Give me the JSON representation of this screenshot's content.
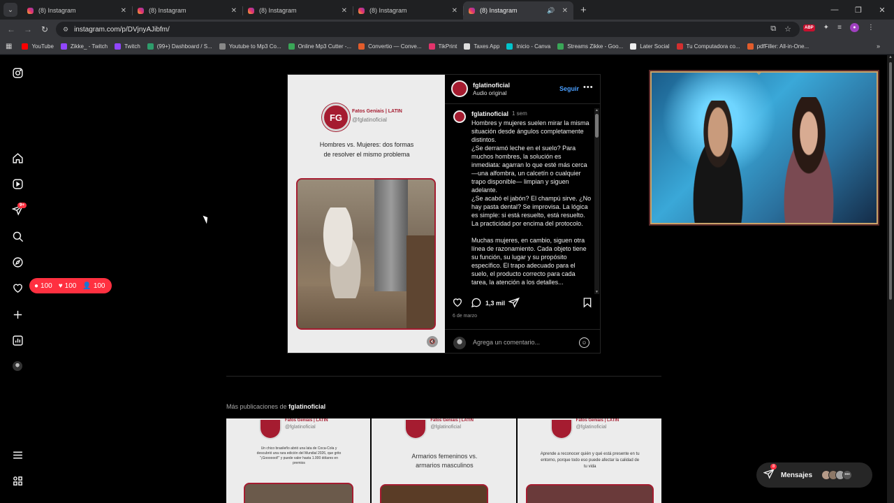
{
  "browser": {
    "tabs": [
      {
        "title": "(8) Instagram",
        "active": false
      },
      {
        "title": "(8) Instagram",
        "active": false
      },
      {
        "title": "(8) Instagram",
        "active": false
      },
      {
        "title": "(8) Instagram",
        "active": false
      },
      {
        "title": "(8) Instagram",
        "active": true
      }
    ],
    "url": "instagram.com/p/DVjnyAJibfm/",
    "bookmarks": [
      {
        "label": "YouTube",
        "color": "#ff0000"
      },
      {
        "label": "Zikke_ - Twitch",
        "color": "#9146ff"
      },
      {
        "label": "Twitch",
        "color": "#9146ff"
      },
      {
        "label": "(99+) Dashboard / S...",
        "color": "#2e9c6b"
      },
      {
        "label": "Youtube to Mp3 Co...",
        "color": "#888888"
      },
      {
        "label": "Online Mp3 Cutter -...",
        "color": "#3aa657"
      },
      {
        "label": "Convertio — Conve...",
        "color": "#e25c2b"
      },
      {
        "label": "TikPrint",
        "color": "#e2336b"
      },
      {
        "label": "Taxes App",
        "color": "#dddddd"
      },
      {
        "label": "Inicio - Canva",
        "color": "#00c4cc"
      },
      {
        "label": "Streams Zikke - Goo...",
        "color": "#3aa657"
      },
      {
        "label": "Later Social",
        "color": "#eeeeee"
      },
      {
        "label": "Tu Computadora co...",
        "color": "#d32f2f"
      },
      {
        "label": "pdfFiller: All-in-One...",
        "color": "#e25c2b"
      }
    ]
  },
  "nav": {
    "badge": "9+",
    "notif_popup": {
      "comments": "100",
      "likes": "100",
      "follows": "100"
    }
  },
  "post": {
    "media": {
      "brand_name": "Fatos Geniais | LATIN",
      "brand_handle": "@fglatinoficial",
      "title": "Hombres vs. Mujeres: dos formas de resolver el mismo problema"
    },
    "header": {
      "username": "fglatinoficial",
      "subtitle": "Audio original",
      "follow_label": "Seguir"
    },
    "caption": {
      "username": "fglatinoficial",
      "time": "1 sem",
      "text": "Hombres y mujeres suelen mirar la misma situación desde ángulos completamente distintos.\n¿Se derramó leche en el suelo? Para muchos hombres, la solución es inmediata: agarran lo que esté más cerca —una alfombra, un calcetín o cualquier trapo disponible— limpian y siguen adelante.\n¿Se acabó el jabón? El champú sirve. ¿No hay pasta dental? Se improvisa. La lógica es simple: si está resuelto, está resuelto. La practicidad por encima del protocolo.\n\nMuchas mujeres, en cambio, siguen otra línea de razonamiento. Cada objeto tiene su función, su lugar y su propósito específico. El trapo adecuado para el suelo, el producto correcto para cada tarea, la atención a los detalles..."
    },
    "comment_count": "1,3 mil",
    "date": "6 de marzo",
    "comment_placeholder": "Agrega un comentario..."
  },
  "more_posts": {
    "prefix": "Más publicaciones de",
    "username": "fglatinoficial",
    "items": [
      {
        "brand": "Fatos Geniais | LATIN",
        "handle": "@fglatinoficial",
        "text": "Un chico brasileño abrió una lata de Coca-Cola y descubrió una rara edición del Mundial 2026, que grito \"¡Gooooool!\" y puede valer hasta 1.000 dólares en premios"
      },
      {
        "brand": "Fatos Geniais | LATIN",
        "handle": "@fglatinoficial",
        "text": "Armarios femeninos vs. armarios masculinos"
      },
      {
        "brand": "Fatos Geniais | LATIN",
        "handle": "@fglatinoficial",
        "text": "Aprende a reconocer quién y qué está presente en tu entorno, porque todo eso puede afectar la calidad de tu vida"
      }
    ]
  },
  "messages": {
    "label": "Mensajes",
    "badge": "8"
  }
}
